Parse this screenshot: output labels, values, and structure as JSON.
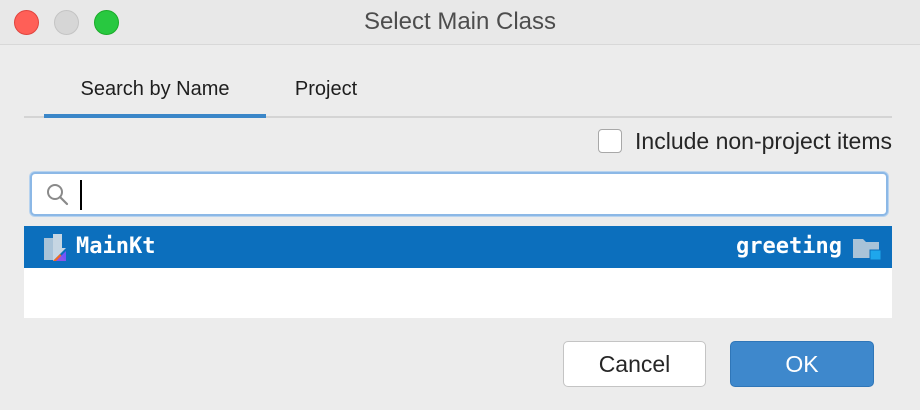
{
  "window": {
    "title": "Select Main Class"
  },
  "tabs": [
    {
      "label": "Search by Name",
      "active": true
    },
    {
      "label": "Project",
      "active": false
    }
  ],
  "options": {
    "include_non_project_label": "Include non-project items",
    "include_non_project_checked": false
  },
  "search": {
    "value": "",
    "placeholder": ""
  },
  "results": [
    {
      "name": "MainKt",
      "module": "greeting",
      "icon": "kotlin-class-icon",
      "module_icon": "module-folder-icon",
      "selected": true
    }
  ],
  "buttons": {
    "cancel_label": "Cancel",
    "ok_label": "OK"
  },
  "colors": {
    "selection": "#0c6fbd",
    "accent": "#3a86c8",
    "ok_button": "#3e88cc",
    "close": "#ff5f57",
    "maximize": "#28c840"
  }
}
